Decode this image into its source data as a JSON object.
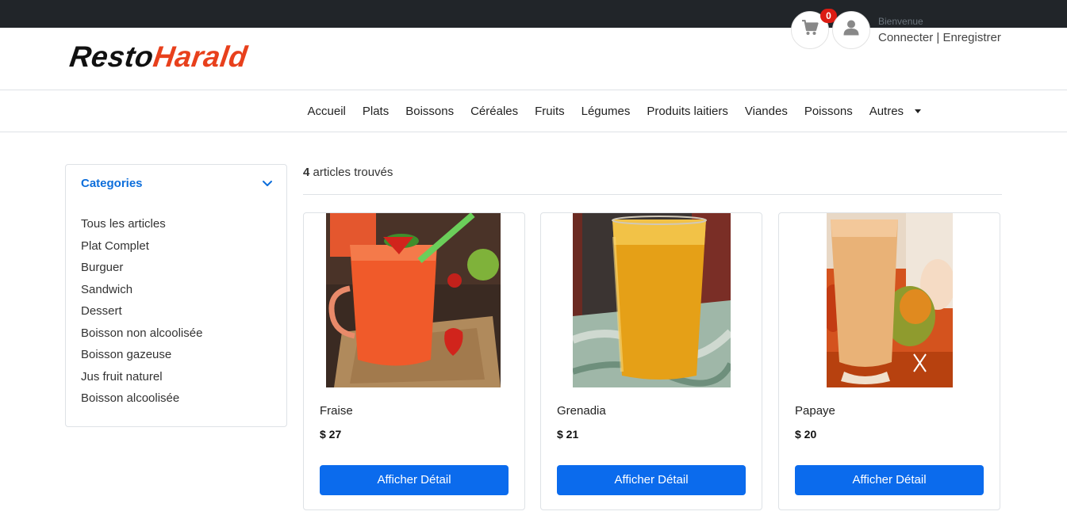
{
  "brand": {
    "part1": "Resto",
    "part2": "Harald"
  },
  "header": {
    "cart_icon": "cart-icon",
    "user_icon": "user-icon",
    "cart_count": "0",
    "welcome": "Bienvenue",
    "login": "Connecter",
    "separator": " | ",
    "register": "Enregistrer"
  },
  "nav": {
    "items": [
      "Accueil",
      "Plats",
      "Boissons",
      "Céréales",
      "Fruits",
      "Légumes",
      "Produits laitiers",
      "Viandes",
      "Poissons",
      "Autres"
    ]
  },
  "sidebar": {
    "title": "Categories",
    "chevron_icon": "chevron-down-icon",
    "categories": [
      "Tous les articles",
      "Plat Complet",
      "Burguer",
      "Sandwich",
      "Dessert",
      "Boisson non alcoolisée",
      "Boisson gazeuse",
      "Jus fruit naturel",
      "Boisson alcoolisée"
    ]
  },
  "results": {
    "count": "4",
    "label": " articles trouvés"
  },
  "products": [
    {
      "name": "Fraise",
      "price": "$ 27",
      "button": "Afficher Détail"
    },
    {
      "name": "Grenadia",
      "price": "$ 21",
      "button": "Afficher Détail"
    },
    {
      "name": "Papaye",
      "price": "$ 20",
      "button": "Afficher Détail"
    }
  ],
  "colors": {
    "accent": "#0b6bed",
    "brand_red": "#e8401c",
    "badge": "#dc1c13",
    "topbar": "#212529"
  }
}
